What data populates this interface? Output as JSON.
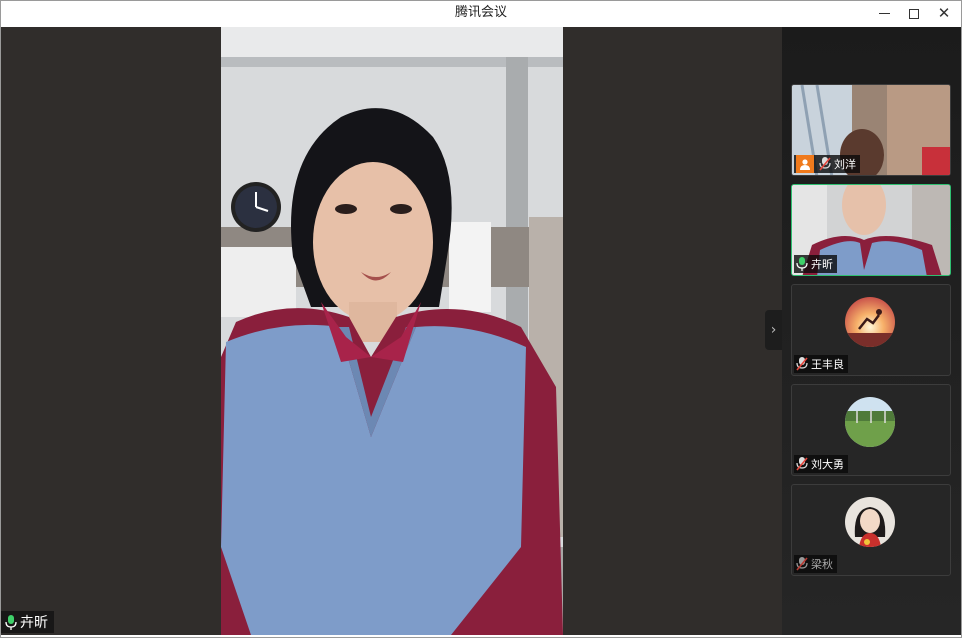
{
  "window": {
    "title": "腾讯会议"
  },
  "main_video": {
    "speaker_name": "卉昕",
    "mic": "mic-on-icon"
  },
  "participants": [
    {
      "name": "刘洋",
      "mic": "mic-muted-icon",
      "host": true,
      "video": true
    },
    {
      "name": "卉昕",
      "mic": "mic-on-icon",
      "host": false,
      "video": true,
      "active": true
    },
    {
      "name": "王丰良",
      "mic": "mic-muted-icon",
      "host": false,
      "video": false
    },
    {
      "name": "刘大勇",
      "mic": "mic-muted-icon",
      "host": false,
      "video": false
    },
    {
      "name": "梁秋",
      "mic": "mic-muted-icon",
      "host": false,
      "video": false
    }
  ],
  "colors": {
    "active_border": "#2fbf71",
    "host_badge": "#f07a1c",
    "stage_bg": "#302d2b"
  }
}
